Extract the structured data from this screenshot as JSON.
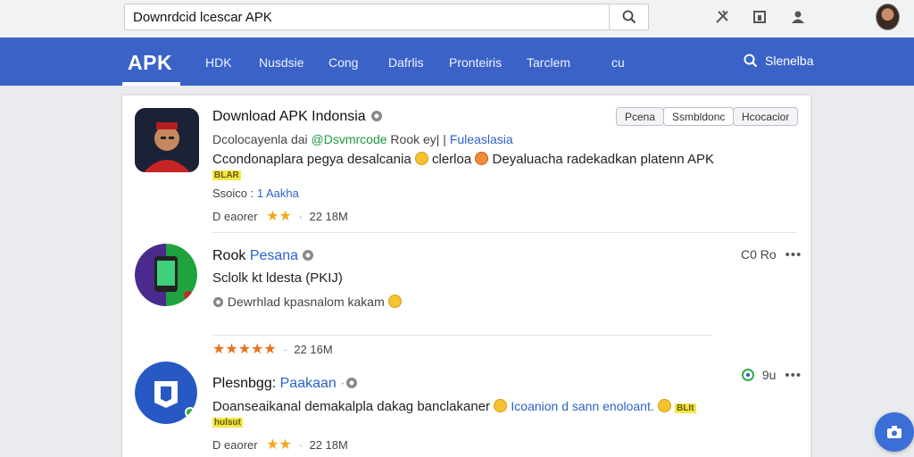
{
  "search": {
    "value": "Downrdcid lcescar APK"
  },
  "nav": {
    "logo": "APK",
    "items": [
      "HDK",
      "Nusdsie",
      "Cong",
      "Dafrlis",
      "Pronteiris",
      "Tarclem",
      "cu"
    ],
    "search_label": "Slenelba"
  },
  "results": [
    {
      "title": "Download APK Indonsia",
      "badges": [
        "Pcena",
        "Ssmbldonc",
        "Hcocacior"
      ],
      "line1_prefix": "Dcolocayenla dai",
      "line1_green": "@Dsvmrcode",
      "line1_mid": "Rook ey| |",
      "line1_link": "Fuleaslasia",
      "desc_a": "Ccondonaplara pegya desalcania",
      "desc_b": "clerloa",
      "desc_c": "Deyaluacha radekadkan platenn APK",
      "tag": "BLAR",
      "meta_label": "Ssoico :",
      "meta_link": "1 Aakha",
      "rating_label": "D eaorer",
      "stars": 2,
      "date": "22 18M"
    },
    {
      "title": "Rook",
      "title_link": "Pesana",
      "right_text": "C0 Ro",
      "line1": "Sclolk kt ldesta (PKIJ)",
      "line2": "Dewrhlad kpasnalom kakam",
      "stars": 5,
      "date": "22 16M"
    },
    {
      "title": "Plesnbgg:",
      "title_link": "Paakaan",
      "right_text": "9u",
      "desc_a": "Doanseaikanal demakalpla dakag banclakaner",
      "desc_link": "Icoanion d sann enoloant.",
      "tag1": "BLIt",
      "tag2": "hulsut",
      "rating_label": "D eaorer",
      "stars": 2,
      "date": "22 18M"
    }
  ],
  "colors": {
    "nav_bg": "#3b63c7",
    "star": "#f2a81d",
    "link": "#2a62c9",
    "green": "#1e9a3c"
  },
  "icons": [
    "search-icon",
    "tools-icon",
    "window-icon",
    "account-icon",
    "camera-icon"
  ]
}
